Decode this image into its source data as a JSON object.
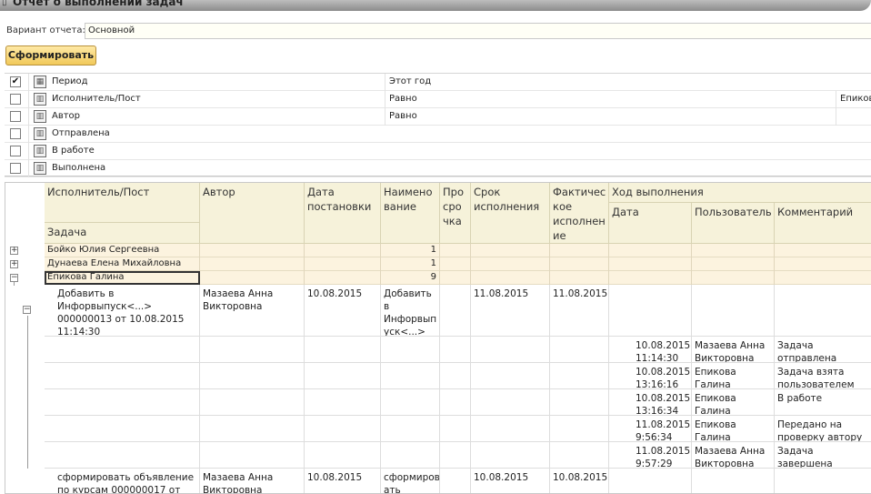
{
  "window": {
    "title": "Отчет о выполнении задач"
  },
  "variant": {
    "label": "Вариант отчета:",
    "value": "Основной"
  },
  "generate_button": {
    "label": "Сформировать"
  },
  "settings": [
    {
      "checked": "✔",
      "name": "Период",
      "comparison": "Этот год",
      "value": ""
    },
    {
      "checked": "",
      "name": "Исполнитель/Пост",
      "comparison": "Равно",
      "value": "Епиков"
    },
    {
      "checked": "",
      "name": "Автор",
      "comparison": "Равно",
      "value": ""
    },
    {
      "checked": "",
      "name": "Отправлена",
      "comparison": "",
      "value": ""
    },
    {
      "checked": "",
      "name": "В работе",
      "comparison": "",
      "value": ""
    },
    {
      "checked": "",
      "name": "Выполнена",
      "comparison": "",
      "value": ""
    }
  ],
  "report": {
    "headers": {
      "executor": "Исполнитель/Пост",
      "task": "Задача",
      "author": "Автор",
      "date_set": "Дата постановки",
      "name": "Наимено вание",
      "overdue": "Про сро чка",
      "deadline": "Срок исполнения",
      "actual": "Фактичес кое исполнен ие",
      "progress": "Ход выполнения",
      "progress_date": "Дата",
      "progress_user": "Пользователь",
      "progress_comment": "Комментарий"
    },
    "groups": [
      {
        "toggle": "+",
        "name": "Бойко Юлия Сергеевна",
        "count": "1"
      },
      {
        "toggle": "+",
        "name": "Дунаева Елена Михайловна",
        "count": "1"
      },
      {
        "toggle": "−",
        "name": "Епикова Галина",
        "count": "9"
      }
    ],
    "task1": {
      "toggle": "−",
      "task": "Добавить в Инфорвыпуск<...> 000000013 от 10.08.2015 11:14:30",
      "author": "Мазаева Анна Викторовна",
      "date_set": "10.08.2015",
      "name": "Добавить в Инфорвып уск<...>",
      "overdue": "",
      "deadline": "11.08.2015",
      "actual": "11.08.2015"
    },
    "progress_rows": [
      {
        "date": "10.08.2015 11:14:30",
        "user": "Мазаева Анна Викторовна",
        "comment": "Задача отправлена"
      },
      {
        "date": "10.08.2015 13:16:16",
        "user": "Епикова Галина",
        "comment": "Задача взята пользователем"
      },
      {
        "date": "10.08.2015 13:16:34",
        "user": "Епикова Галина",
        "comment": "В работе"
      },
      {
        "date": "11.08.2015 9:56:34",
        "user": "Епикова Галина",
        "comment": "Передано на проверку автору"
      },
      {
        "date": "11.08.2015 9:57:29",
        "user": "Мазаева Анна Викторовна",
        "comment": "Задача завершена"
      }
    ],
    "task2": {
      "task": "сформировать объявление по курсам 000000017 от",
      "author": "Мазаева Анна Викторовна",
      "date_set": "10.08.2015",
      "name": "сформиров ать",
      "deadline": "10.08.2015",
      "actual": "10.08.2015"
    }
  }
}
